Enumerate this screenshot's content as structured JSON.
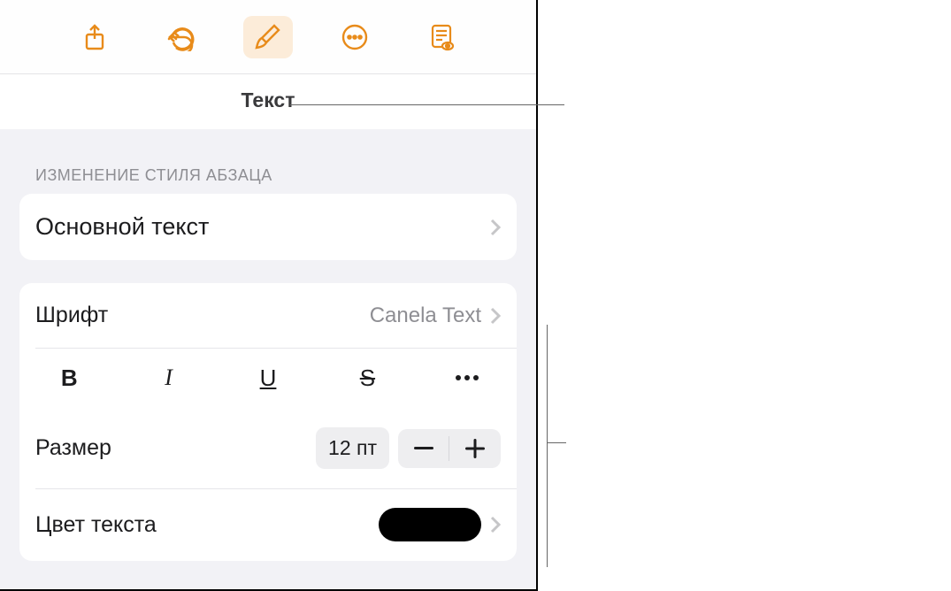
{
  "toolbar": {
    "share_icon": "share",
    "undo_icon": "undo",
    "brush_icon": "brush",
    "more_icon": "more",
    "reader_icon": "reader"
  },
  "tab": {
    "text_label": "Текст"
  },
  "section": {
    "paragraph_style_header": "ИЗМЕНЕНИЕ СТИЛЯ АБЗАЦА",
    "body_text_label": "Основной текст"
  },
  "font": {
    "label": "Шрифт",
    "value": "Canela Text"
  },
  "format": {
    "bold": "B",
    "italic": "I",
    "underline": "U",
    "strike": "S"
  },
  "size": {
    "label": "Размер",
    "value": "12 пт"
  },
  "color": {
    "label": "Цвет текста",
    "value": "#000000"
  }
}
